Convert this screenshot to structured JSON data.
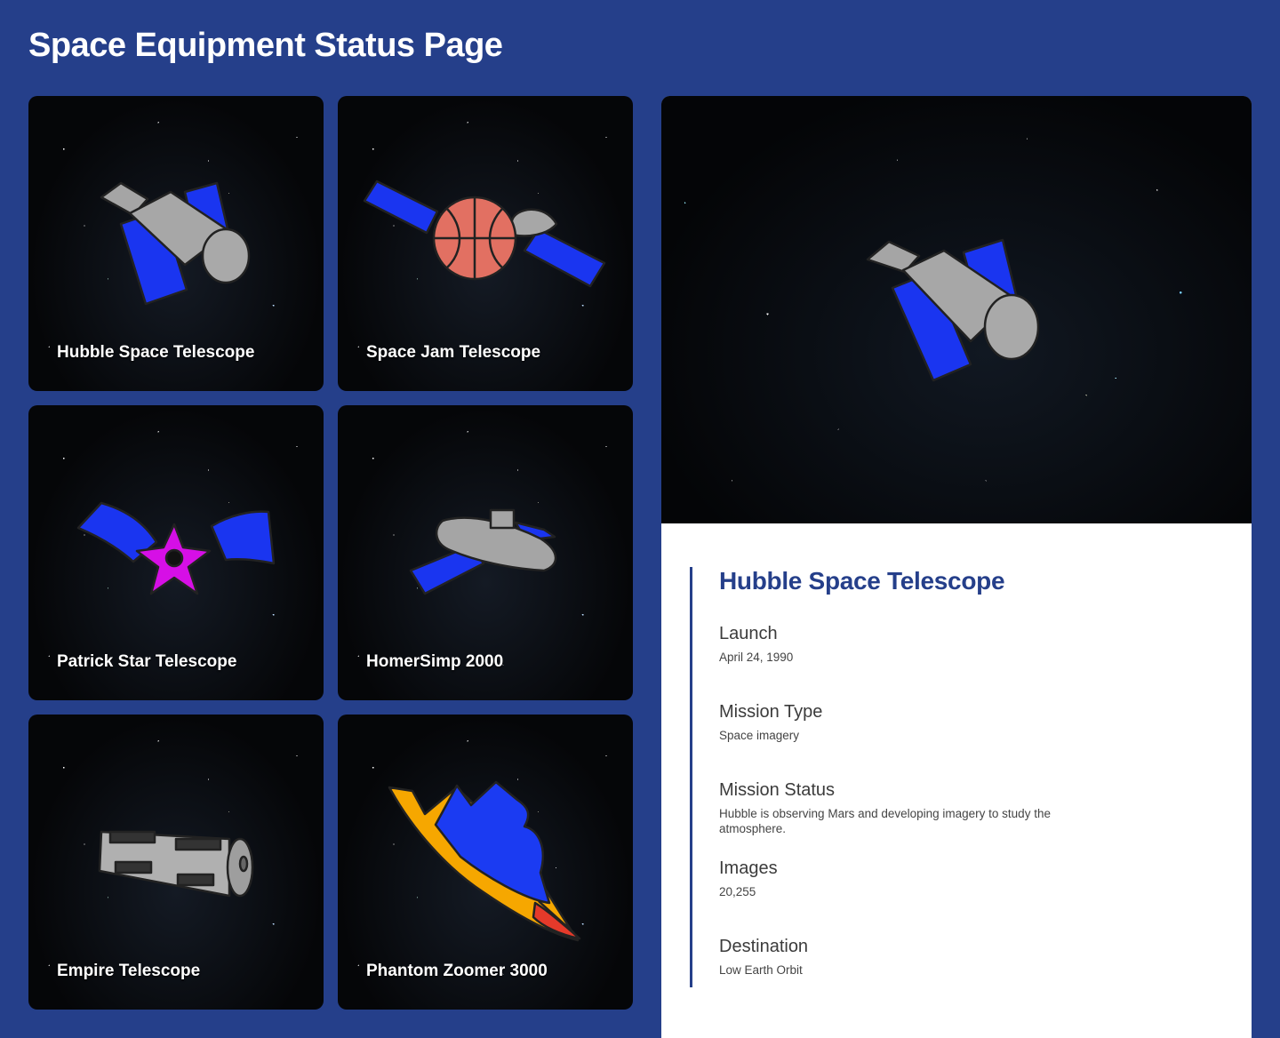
{
  "page": {
    "title": "Space Equipment Status Page"
  },
  "equipment": [
    {
      "name": "Hubble Space Telescope",
      "icon": "hubble-telescope-icon"
    },
    {
      "name": "Space Jam Telescope",
      "icon": "basketball-telescope-icon"
    },
    {
      "name": "Patrick Star Telescope",
      "icon": "starfish-telescope-icon"
    },
    {
      "name": "HomerSimp 2000",
      "icon": "satellite-icon"
    },
    {
      "name": "Empire Telescope",
      "icon": "cylinder-telescope-icon"
    },
    {
      "name": "Phantom Zoomer 3000",
      "icon": "spaceship-icon"
    }
  ],
  "detail": {
    "title": "Hubble Space Telescope",
    "fields": [
      {
        "label": "Launch",
        "value": "April 24, 1990"
      },
      {
        "label": "Mission Type",
        "value": "Space imagery"
      },
      {
        "label": "Mission Status",
        "value": "Hubble is observing Mars and developing imagery to study the atmosphere."
      },
      {
        "label": "Images",
        "value": "20,255"
      },
      {
        "label": "Destination",
        "value": "Low Earth Orbit"
      }
    ]
  },
  "colors": {
    "background": "#253f8a",
    "accent": "#253f8a",
    "panel": "#ffffff",
    "solar_panel": "#1a35f0",
    "body_gray": "#a7a7a7"
  }
}
